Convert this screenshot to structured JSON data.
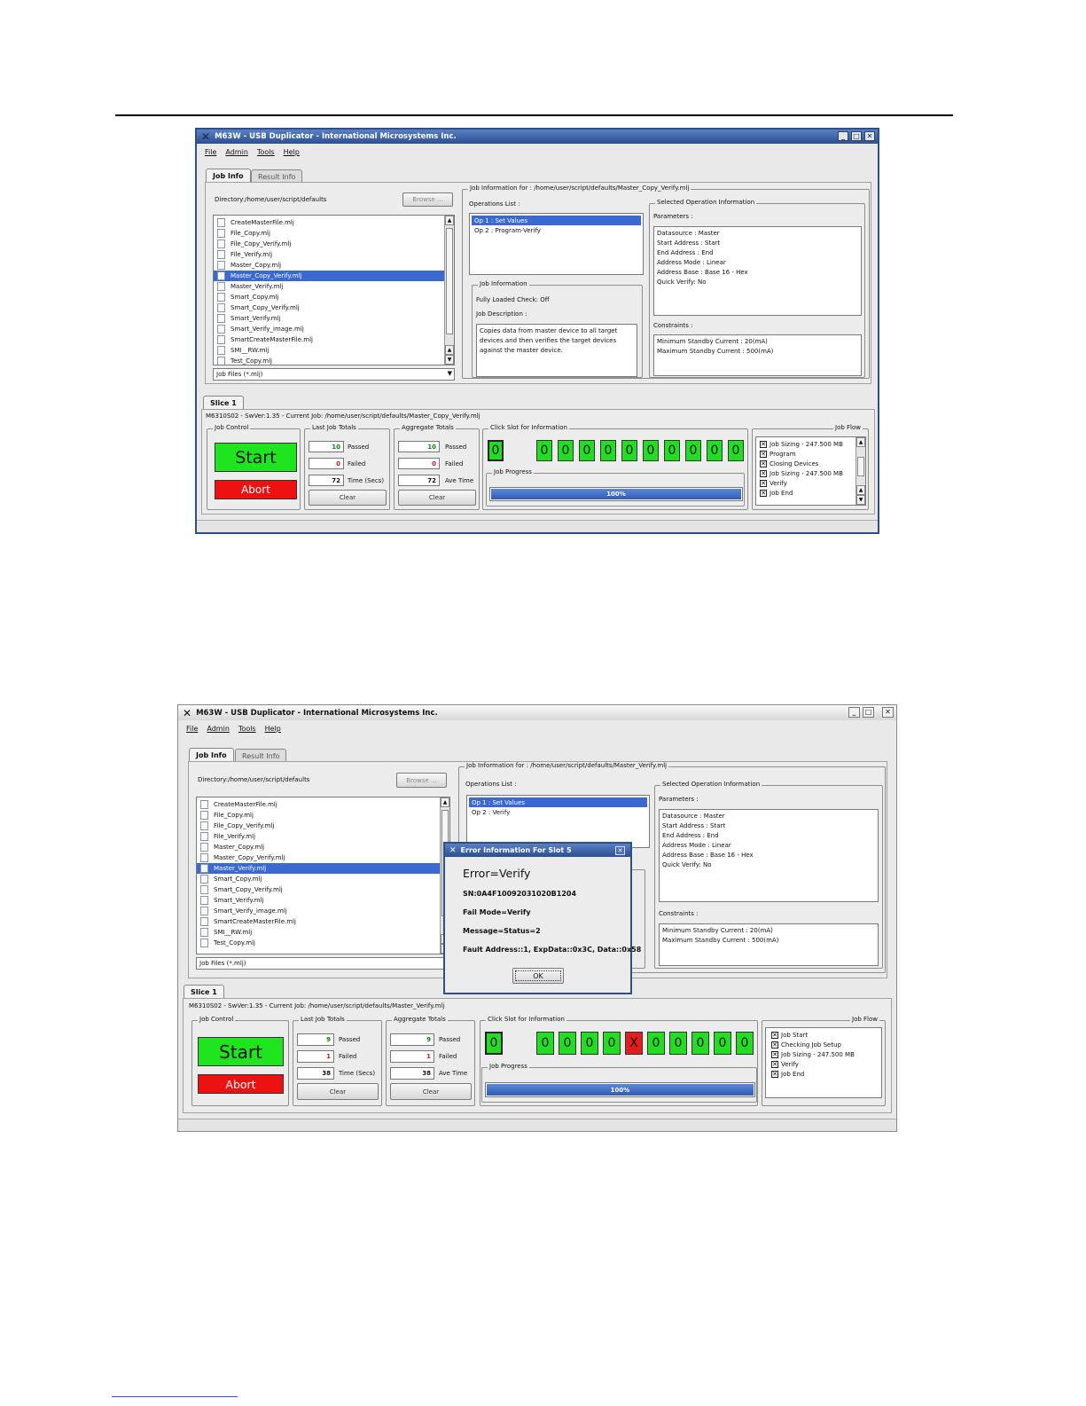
{
  "window_title": "M63W - USB Duplicator - International Microsystems Inc.",
  "menu": [
    "File",
    "Admin",
    "Tools",
    "Help"
  ],
  "tabs": {
    "job_info": "Job Info",
    "result_info": "Result Info"
  },
  "directory_label": "Directory:",
  "directory_value": "/home/user/script/defaults",
  "browse_label": "Browse ...",
  "file_filter": "Job Files (*.mlj)",
  "files_1": [
    "CreateMasterFile.mlj",
    "File_Copy.mlj",
    "File_Copy_Verify.mlj",
    "File_Verify.mlj",
    "Master_Copy.mlj",
    "Master_Copy_Verify.mlj",
    "Master_Verify.mlj",
    "Smart_Copy.mlj",
    "Smart_Copy_Verify.mlj",
    "Smart_Verify.mlj",
    "Smart_Verify_image.mlj",
    "SmartCreateMasterFile.mlj",
    "SMI__RW.mlj",
    "Test_Copy.mlj"
  ],
  "selected_file_1": "Master_Copy_Verify.mlj",
  "selected_file_2": "Master_Verify.mlj",
  "job_info_title_1": "Job Information for : /home/user/script/defaults/Master_Copy_Verify.mlj",
  "job_info_title_2": "Job Information for : /home/user/script/defaults/Master_Verify.mlj",
  "operations_list_label": "Operations List :",
  "ops_1": [
    "Op 1 : Set Values",
    "Op 2 : Program-Verify"
  ],
  "ops_2": [
    "Op 1 : Set Values",
    "Op 2 : Verify"
  ],
  "job_information_label": "Job Information",
  "fully_loaded_check": "Fully Loaded Check: Off",
  "job_description_label": "Job Description :",
  "job_description": [
    "Copies data from master device to all target",
    "devices and then verifies the target devices",
    "against the master device."
  ],
  "selected_op_info_label": "Selected Operation Information",
  "parameters_label": "Parameters :",
  "parameters": [
    "Datasource : Master",
    "Start Address : Start",
    "End Address : End",
    "Address Mode : Linear",
    "Address Base : Base 16 - Hex",
    "Quick Verify: No"
  ],
  "constraints_label": "Constraints :",
  "constraints": [
    "Minimum Standby Current : 20(mA)",
    "Maximum Standby Current : 500(mA)"
  ],
  "slice_tab": "Slice 1",
  "slice_info_1": "M6310S02 - SwVer:1.35 - Current Job: /home/user/script/defaults/Master_Copy_Verify.mlj",
  "slice_info_2": "M6310S02 - SwVer:1.35 - Current Job: /home/user/script/defaults/Master_Verify.mlj",
  "job_control_label": "Job Control",
  "start_label": "Start",
  "abort_label": "Abort",
  "last_job_totals_label": "Last Job Totals",
  "aggregate_totals_label": "Aggregate Totals",
  "passed_label": "Passed",
  "failed_label": "Failed",
  "time_label": "Time (Secs)",
  "ave_time_label": "Ave Time",
  "clear_label": "Clear",
  "totals_1": {
    "last_passed": "10",
    "last_failed": "0",
    "last_time": "72",
    "agg_passed": "10",
    "agg_failed": "0",
    "agg_time": "72"
  },
  "totals_2": {
    "last_passed": "9",
    "last_failed": "1",
    "last_time": "38",
    "agg_passed": "9",
    "agg_failed": "1",
    "agg_time": "38"
  },
  "click_slot_label": "Click Slot for Information",
  "slots_1": [
    "0",
    "0",
    "0",
    "0",
    "0",
    "0",
    "0",
    "0",
    "0",
    "0",
    "0"
  ],
  "slots_2": [
    "0",
    "0",
    "0",
    "0",
    "0",
    "X",
    "0",
    "0",
    "0",
    "0",
    "0"
  ],
  "job_progress_label": "Job Progress",
  "progress_text": "100%",
  "progress_value": 1.0,
  "job_flow_label": "Job Flow",
  "flow_1": [
    "Job Sizing - 247.500 MB",
    "Program",
    "Closing Devices",
    "Job Sizing - 247.500 MB",
    "Verify",
    "Job End"
  ],
  "flow_2": [
    "Job Start",
    "Checking Job Setup",
    "Job Sizing - 247.500 MB",
    "Verify",
    "Job End"
  ],
  "dialog": {
    "title": "Error Information For Slot 5",
    "error": "Error=Verify",
    "sn": "SN:0A4F10092031020B1204",
    "fail_mode": "Fail Mode=Verify",
    "message": "Message=Status=2",
    "fault": "Fault Address::1, ExpData::0x3C, Data::0x58",
    "ok": "OK"
  },
  "colors": {
    "slot_pass": "#22dd22",
    "slot_fail": "#e21d1d",
    "selection": "#3a6ad1",
    "start": "#1ee51e",
    "abort": "#ee1111"
  }
}
